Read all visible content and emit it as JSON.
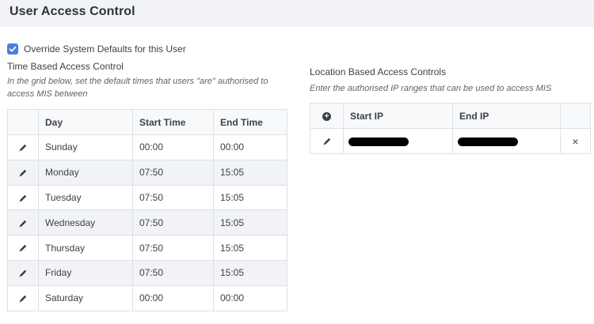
{
  "header": {
    "title": "User Access Control"
  },
  "override": {
    "label": "Override System Defaults for this User",
    "checked": true
  },
  "time_section": {
    "title": "Time Based Access Control",
    "hint": "In the grid below, set the default times that users \"are\" authorised to access MIS between",
    "columns": {
      "day": "Day",
      "start": "Start Time",
      "end": "End Time"
    },
    "rows": [
      {
        "day": "Sunday",
        "start": "00:00",
        "end": "00:00"
      },
      {
        "day": "Monday",
        "start": "07:50",
        "end": "15:05"
      },
      {
        "day": "Tuesday",
        "start": "07:50",
        "end": "15:05"
      },
      {
        "day": "Wednesday",
        "start": "07:50",
        "end": "15:05"
      },
      {
        "day": "Thursday",
        "start": "07:50",
        "end": "15:05"
      },
      {
        "day": "Friday",
        "start": "07:50",
        "end": "15:05"
      },
      {
        "day": "Saturday",
        "start": "00:00",
        "end": "00:00"
      }
    ]
  },
  "location_section": {
    "title": "Location Based Access Controls",
    "hint": "Enter the authorised IP ranges that can be used to access MIS",
    "columns": {
      "start_ip": "Start IP",
      "end_ip": "End IP"
    },
    "rows": [
      {
        "start_ip_redacted": true,
        "end_ip_redacted": true,
        "delete_symbol": "×"
      }
    ]
  },
  "icons": {
    "edit": "pencil-icon",
    "add": "plus-circle-icon",
    "delete": "close-icon",
    "check": "check-icon"
  },
  "colors": {
    "header_bg": "#f1f3f6",
    "checkbox": "#4a7fd8",
    "row_alt": "#f1f3f6",
    "border": "#dde1e6"
  }
}
